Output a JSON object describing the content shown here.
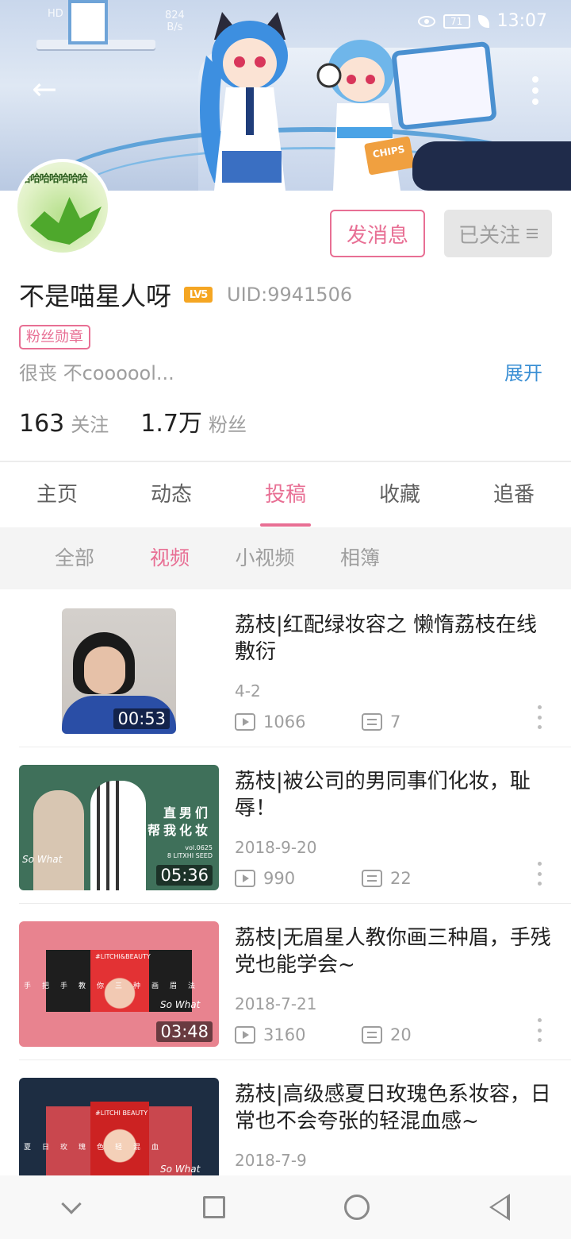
{
  "status_bar": {
    "network": "HD",
    "speed": "824",
    "speed_unit": "B/s",
    "battery": "71",
    "time": "13:07"
  },
  "banner": {
    "chips_text": "CHIPS"
  },
  "header_actions": {
    "back_icon": "←"
  },
  "profile": {
    "avatar_text": "哈哈哈哈哈哈哈",
    "message_button": "发消息",
    "followed_button": "已关注",
    "username": "不是喵星人呀",
    "level": "LV5",
    "uid": "UID:9941506",
    "fan_badge": "粉丝勋章",
    "bio": "很丧 不coooool...",
    "expand": "展开",
    "following_count": "163",
    "following_label": "关注",
    "followers_count": "1.7万",
    "followers_label": "粉丝"
  },
  "tabs": [
    {
      "label": "主页",
      "active": false
    },
    {
      "label": "动态",
      "active": false
    },
    {
      "label": "投稿",
      "active": true
    },
    {
      "label": "收藏",
      "active": false
    },
    {
      "label": "追番",
      "active": false
    }
  ],
  "subtabs": [
    {
      "label": "全部",
      "active": false
    },
    {
      "label": "视频",
      "active": true
    },
    {
      "label": "小视频",
      "active": false
    },
    {
      "label": "相簿",
      "active": false
    }
  ],
  "videos": [
    {
      "title": "荔枝|红配绿妆容之 懒惰荔枝在线敷衍",
      "date": "4-2",
      "views": "1066",
      "comments": "7",
      "duration": "00:53"
    },
    {
      "title": "荔枝|被公司的男同事们化妆，耻辱！",
      "date": "2018-9-20",
      "views": "990",
      "comments": "22",
      "duration": "05:36",
      "thumb_caption_1": "直男们",
      "thumb_caption_2": "帮我化妆",
      "thumb_caption_3": "vol.0625",
      "thumb_caption_4": "8 LITXHI SEED",
      "thumb_signature": "So What"
    },
    {
      "title": "荔枝|无眉星人教你画三种眉，手残党也能学会~",
      "date": "2018-7-21",
      "views": "3160",
      "comments": "20",
      "duration": "03:48",
      "thumb_caption_1": "手把手教你三种画眉法",
      "thumb_caption_2": "#LITCHI&BEAUTY",
      "thumb_signature": "So What"
    },
    {
      "title": "荔枝|高级感夏日玫瑰色系妆容，日常也不会夸张的轻混血感~",
      "date": "2018-7-9",
      "thumb_caption_1": "夏日玫瑰色轻混血",
      "thumb_caption_2": "#LITCHI BEAUTY",
      "thumb_signature": "So What"
    }
  ],
  "colors": {
    "accent": "#e86f94",
    "link": "#3a8fd4",
    "secondary_text": "#9e9e9e"
  }
}
